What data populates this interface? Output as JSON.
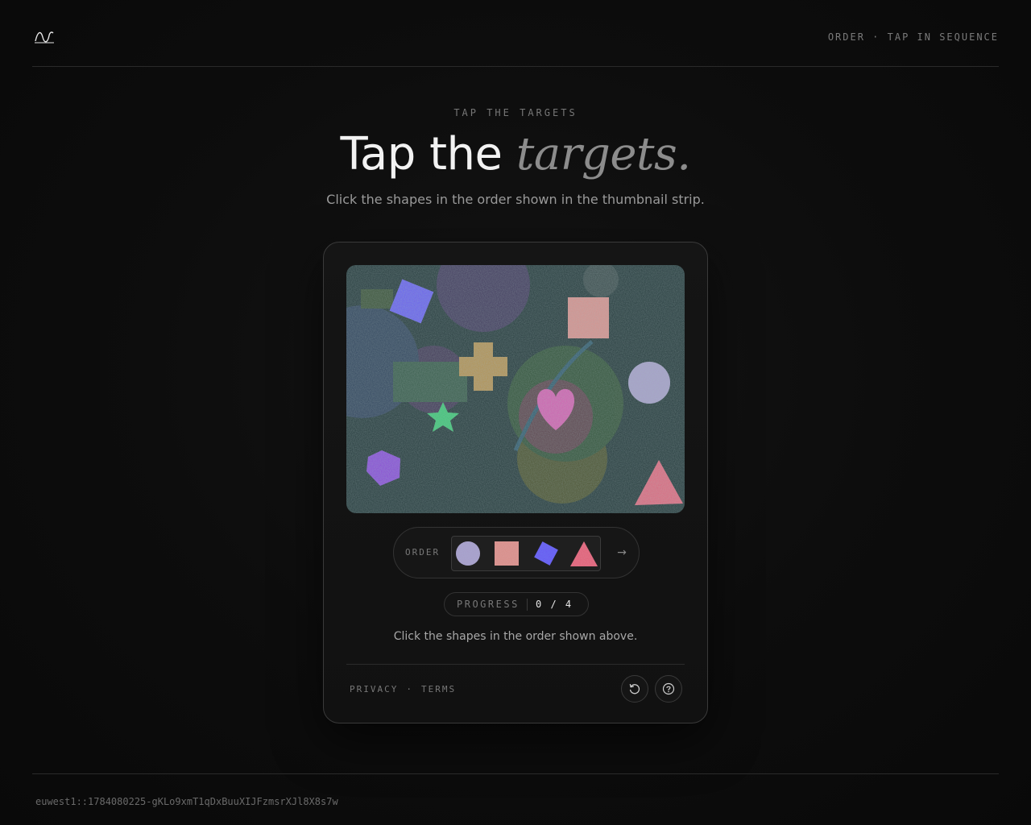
{
  "header": {
    "logo": "wave-logo-icon",
    "mode_label": "ORDER · TAP IN SEQUENCE"
  },
  "hero": {
    "eyebrow": "TAP THE TARGETS",
    "title_plain": "Tap the",
    "title_italic": "targets.",
    "subtitle": "Click the shapes in the order shown in the thumbnail strip."
  },
  "challenge": {
    "canvas_background": "#2c4545",
    "targets": [
      {
        "shape": "square",
        "color": "#6a4ff0"
      },
      {
        "shape": "square",
        "color": "#d98a86"
      },
      {
        "shape": "cross",
        "color": "#b48a3c"
      },
      {
        "shape": "circle",
        "color": "#a89ac8"
      },
      {
        "shape": "heart",
        "color": "#d44fae"
      },
      {
        "shape": "star",
        "color": "#3fc46a"
      },
      {
        "shape": "pentagon",
        "color": "#8a2fd8"
      },
      {
        "shape": "triangle",
        "color": "#e05a75"
      }
    ],
    "order_label": "ORDER",
    "order": [
      {
        "shape": "circle",
        "color": "#a89ac8",
        "icon": "circle-thumb-icon"
      },
      {
        "shape": "square",
        "color": "#d98a86",
        "icon": "square-thumb-icon"
      },
      {
        "shape": "diamond",
        "color": "#6a4ff0",
        "icon": "diamond-thumb-icon"
      },
      {
        "shape": "triangle",
        "color": "#e05a75",
        "icon": "triangle-thumb-icon"
      }
    ],
    "next_arrow": "→",
    "progress_label": "PROGRESS",
    "progress_value": "0 / 4",
    "instruction": "Click the shapes in the order shown above."
  },
  "card_footer": {
    "privacy": "PRIVACY",
    "separator": "·",
    "terms": "TERMS",
    "buttons": [
      "refresh-icon",
      "help-icon"
    ]
  },
  "footer": {
    "session_id": "euwest1::1784080225-gKLo9xmT1qDxBuuXIJFzmsrXJl8X8s7w"
  }
}
